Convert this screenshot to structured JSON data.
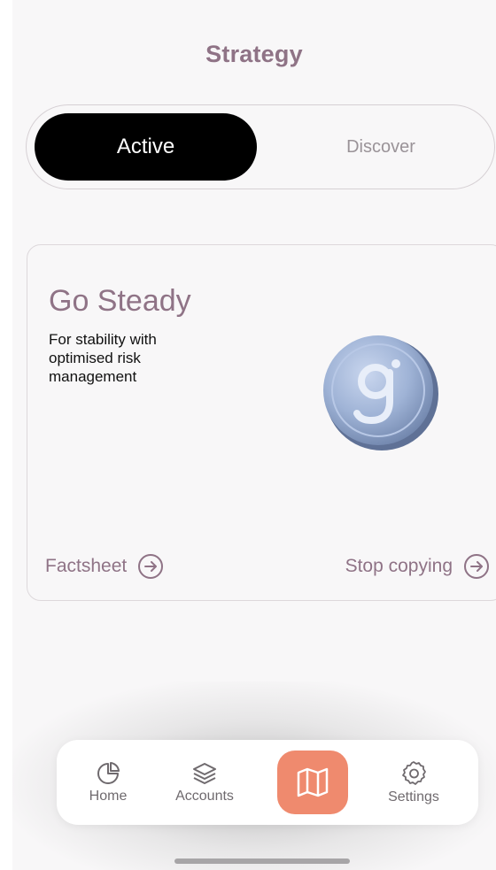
{
  "header": {
    "title": "Strategy"
  },
  "segmented": {
    "active_label": "Active",
    "inactive_label": "Discover",
    "selected": "Active"
  },
  "card": {
    "title": "Go Steady",
    "description": "For stability with optimised risk management",
    "coin_icon": "g-coin-logo-icon",
    "factsheet_label": "Factsheet",
    "stop_copying_label": "Stop copying"
  },
  "tabbar": {
    "items": [
      {
        "label": "Home",
        "icon": "pie-chart-icon"
      },
      {
        "label": "Accounts",
        "icon": "layers-icon"
      },
      {
        "label": "",
        "icon": "map-icon",
        "selected": true
      },
      {
        "label": "Settings",
        "icon": "gear-icon"
      }
    ]
  },
  "colors": {
    "accent": "#8f7386",
    "active_tab_bg": "#ef8a6e",
    "segment_active_bg": "#000000",
    "coin": "#9fb3d6"
  }
}
